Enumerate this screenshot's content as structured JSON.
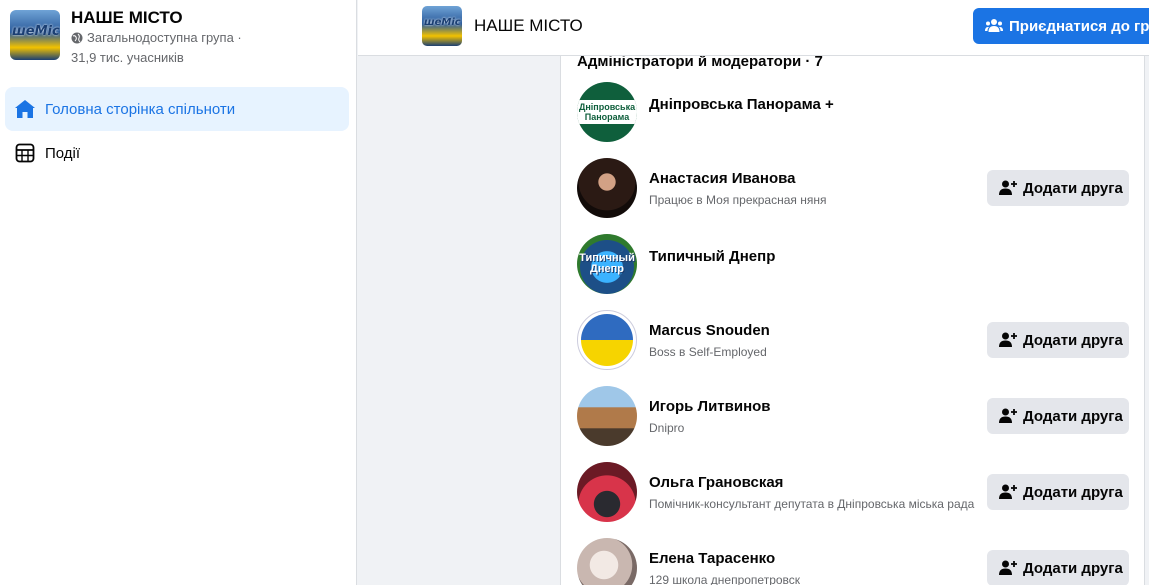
{
  "group": {
    "name": "НАШЕ МІСТО",
    "privacy": "Загальнодоступна група ·",
    "members": "31,9 тис. учасників",
    "thumb_text": "шеМіс"
  },
  "sidebar": {
    "items": [
      {
        "label": "Головна сторінка спільноти",
        "icon": "home-icon",
        "active": true
      },
      {
        "label": "Події",
        "icon": "calendar-icon",
        "active": false
      }
    ]
  },
  "topbar": {
    "title": "НАШЕ МІСТО",
    "join_label": "Приєднатися до гру"
  },
  "admins": {
    "section_title": "Адміністратори й модератори · 7",
    "add_friend_label": "Додати друга",
    "members": [
      {
        "name": "Дніпровська Панорама +",
        "subtitle": "",
        "has_add": false,
        "avatar_text": "Дніпровська Панорама"
      },
      {
        "name": "Анастасия Иванова",
        "subtitle": "Працює в Моя прекрасная няня",
        "has_add": true
      },
      {
        "name": "Типичный Днепр",
        "subtitle": "",
        "has_add": false,
        "avatar_text": "Типичный Днепр"
      },
      {
        "name": "Marcus Snouden",
        "subtitle": "Boss в Self-Employed",
        "has_add": true
      },
      {
        "name": "Игорь Литвинов",
        "subtitle": "Dnipro",
        "has_add": true
      },
      {
        "name": "Ольга Грановская",
        "subtitle": "Помічник-консультант депутата в Дніпровська міська рада",
        "has_add": true
      },
      {
        "name": "Елена Тарасенко",
        "subtitle": "129 школа днепропетровск",
        "has_add": true
      }
    ]
  },
  "colors": {
    "accent": "#1b74e4",
    "active_bg": "#e7f3ff",
    "button_grey": "#e4e6eb",
    "page_bg": "#f0f2f5"
  }
}
